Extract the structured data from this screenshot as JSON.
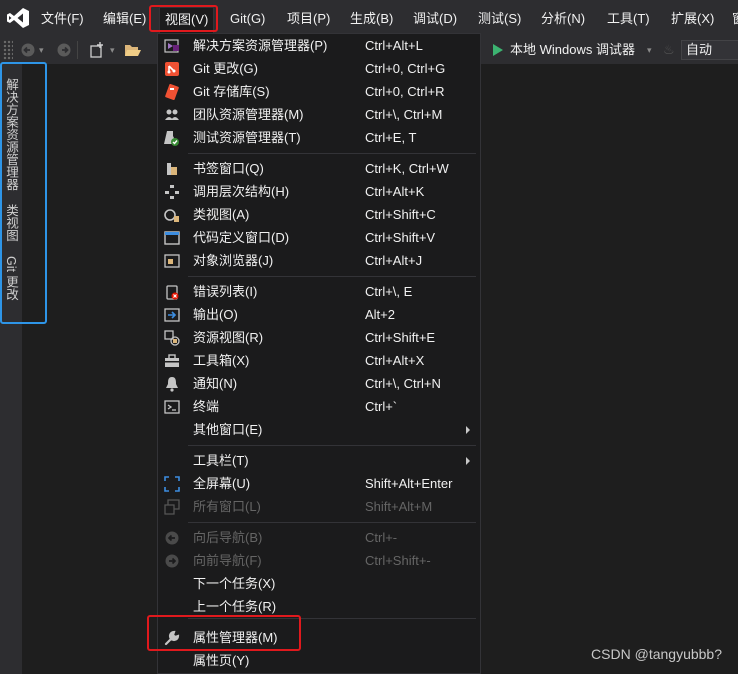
{
  "menubar": {
    "items": [
      "文件(F)",
      "编辑(E)",
      "视图(V)",
      "Git(G)",
      "项目(P)",
      "生成(B)",
      "调试(D)",
      "测试(S)",
      "分析(N)",
      "工具(T)",
      "扩展(X)",
      "窗"
    ]
  },
  "toolbar": {
    "run_label": "本地 Windows 调试器",
    "config_value": "自动"
  },
  "sidebar": {
    "tabs": [
      "解决方案资源管理器",
      "类视图",
      "Git 更改"
    ]
  },
  "view_menu": {
    "items": [
      {
        "label": "解决方案资源管理器(P)",
        "shortcut": "Ctrl+Alt+L",
        "icon": "solution-explorer-icon"
      },
      {
        "label": "Git 更改(G)",
        "shortcut": "Ctrl+0, Ctrl+G",
        "icon": "git-changes-icon"
      },
      {
        "label": "Git 存储库(S)",
        "shortcut": "Ctrl+0, Ctrl+R",
        "icon": "git-repository-icon"
      },
      {
        "label": "团队资源管理器(M)",
        "shortcut": "Ctrl+\\, Ctrl+M",
        "icon": "team-explorer-icon"
      },
      {
        "label": "测试资源管理器(T)",
        "shortcut": "Ctrl+E, T",
        "icon": "test-explorer-icon"
      },
      {
        "label": "书签窗口(Q)",
        "shortcut": "Ctrl+K, Ctrl+W",
        "icon": "bookmark-icon"
      },
      {
        "label": "调用层次结构(H)",
        "shortcut": "Ctrl+Alt+K",
        "icon": "call-hierarchy-icon"
      },
      {
        "label": "类视图(A)",
        "shortcut": "Ctrl+Shift+C",
        "icon": "class-view-icon"
      },
      {
        "label": "代码定义窗口(D)",
        "shortcut": "Ctrl+Shift+V",
        "icon": "code-definition-icon"
      },
      {
        "label": "对象浏览器(J)",
        "shortcut": "Ctrl+Alt+J",
        "icon": "object-browser-icon"
      },
      {
        "label": "错误列表(I)",
        "shortcut": "Ctrl+\\, E",
        "icon": "error-list-icon"
      },
      {
        "label": "输出(O)",
        "shortcut": "Alt+2",
        "icon": "output-icon"
      },
      {
        "label": "资源视图(R)",
        "shortcut": "Ctrl+Shift+E",
        "icon": "resource-view-icon"
      },
      {
        "label": "工具箱(X)",
        "shortcut": "Ctrl+Alt+X",
        "icon": "toolbox-icon"
      },
      {
        "label": "通知(N)",
        "shortcut": "Ctrl+\\, Ctrl+N",
        "icon": "notification-bell-icon"
      },
      {
        "label": "终端",
        "shortcut": "Ctrl+`",
        "icon": "terminal-icon"
      },
      {
        "label": "其他窗口(E)",
        "shortcut": "",
        "icon": ""
      },
      {
        "label": "工具栏(T)",
        "shortcut": "",
        "icon": ""
      },
      {
        "label": "全屏幕(U)",
        "shortcut": "Shift+Alt+Enter",
        "icon": "fullscreen-icon"
      },
      {
        "label": "所有窗口(L)",
        "shortcut": "Shift+Alt+M",
        "icon": "all-windows-icon"
      },
      {
        "label": "向后导航(B)",
        "shortcut": "Ctrl+-",
        "icon": "navigate-back-icon"
      },
      {
        "label": "向前导航(F)",
        "shortcut": "Ctrl+Shift+-",
        "icon": "navigate-forward-icon"
      },
      {
        "label": "下一个任务(X)",
        "shortcut": "",
        "icon": ""
      },
      {
        "label": "上一个任务(R)",
        "shortcut": "",
        "icon": ""
      },
      {
        "label": "属性管理器(M)",
        "shortcut": "",
        "icon": "wrench-icon"
      },
      {
        "label": "属性页(Y)",
        "shortcut": "",
        "icon": ""
      }
    ]
  },
  "watermark": "CSDN @tangyubbb?",
  "colors": {
    "highlight_red": "#e0191d",
    "highlight_blue": "#2e95e7",
    "run_green": "#3cb371",
    "vs_purple": "#68217a"
  }
}
